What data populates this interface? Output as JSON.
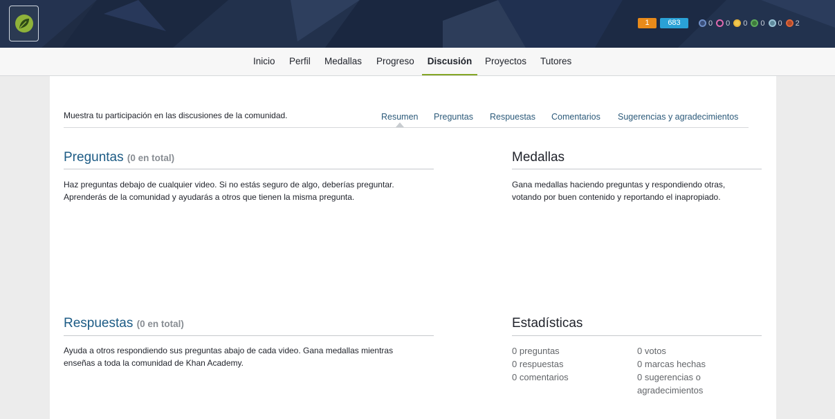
{
  "header": {
    "level": "1",
    "points": "683",
    "medals": [
      {
        "icon": "meteorite-badge-icon",
        "color": "#6f8fc7",
        "count": "0"
      },
      {
        "icon": "moon-badge-icon",
        "color": "#e06ab0",
        "count": "0"
      },
      {
        "icon": "earth-badge-icon",
        "color": "#e8b43a",
        "count": "0"
      },
      {
        "icon": "sun-badge-icon",
        "color": "#5fae5c",
        "count": "0"
      },
      {
        "icon": "black-hole-badge-icon",
        "color": "#9ac3d6",
        "count": "0"
      },
      {
        "icon": "challenge-patch-icon",
        "color": "#e0663a",
        "count": "2"
      }
    ]
  },
  "nav": {
    "tabs": [
      "Inicio",
      "Perfil",
      "Medallas",
      "Progreso",
      "Discusión",
      "Proyectos",
      "Tutores"
    ],
    "active": "Discusión"
  },
  "discussion": {
    "intro": "Muestra tu participación en las discusiones de la comunidad.",
    "subtabs": [
      "Resumen",
      "Preguntas",
      "Respuestas",
      "Comentarios",
      "Sugerencias y agradecimientos"
    ],
    "questions": {
      "title": "Preguntas",
      "count": "(0 en total)",
      "line1": "Haz preguntas debajo de cualquier video. Si no estás seguro de algo, deberías preguntar.",
      "line2": "Aprenderás de la comunidad y ayudarás a otros que tienen la misma pregunta."
    },
    "medals": {
      "title": "Medallas",
      "line1": "Gana medallas haciendo preguntas y respondiendo otras,",
      "line2": "votando por buen contenido y reportando el inapropiado."
    },
    "answers": {
      "title": "Respuestas",
      "count": "(0 en total)",
      "line1": "Ayuda a otros respondiendo sus preguntas abajo de cada video. Gana medallas mientras",
      "line2": "enseñas a toda la comunidad de Khan Academy."
    },
    "stats": {
      "title": "Estadísticas",
      "left": [
        {
          "num": "0",
          "label": "preguntas"
        },
        {
          "num": "0",
          "label": "respuestas"
        },
        {
          "num": "0",
          "label": "comentarios"
        }
      ],
      "right": [
        {
          "num": "0",
          "label": "votos"
        },
        {
          "num": "0",
          "label": "marcas hechas"
        },
        {
          "num": "0",
          "label": "sugerencias o"
        },
        {
          "num": "",
          "label": "agradecimientos"
        }
      ]
    }
  }
}
